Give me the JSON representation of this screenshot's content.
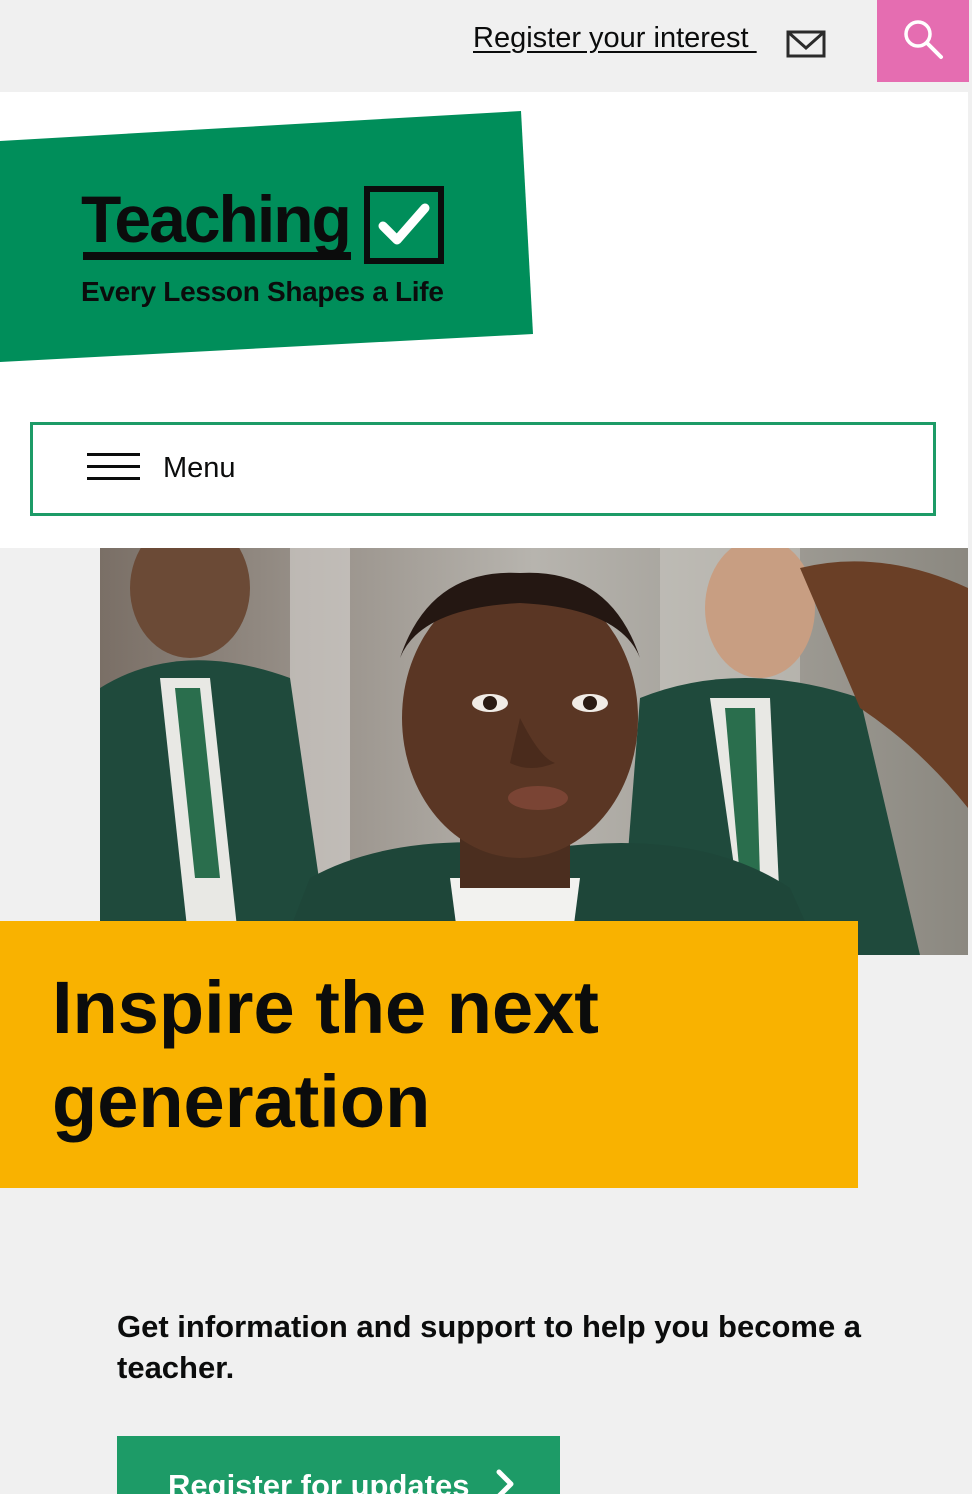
{
  "topbar": {
    "register_label": "Register your interest ",
    "mail_icon": "mail-icon",
    "search_icon": "search-icon",
    "search_color": "#e56db1"
  },
  "logo": {
    "word": "Teaching",
    "tagline": "Every Lesson Shapes a Life",
    "brand_color": "#008e5a"
  },
  "menu": {
    "label": "Menu",
    "border_color": "#1d9b67"
  },
  "hero": {
    "title": "Inspire the next generation",
    "box_color": "#f9b200"
  },
  "intro": {
    "text": "Get information and support to help you become a teacher."
  },
  "cta": {
    "label": "Register for updates",
    "color": "#1d9b67"
  }
}
